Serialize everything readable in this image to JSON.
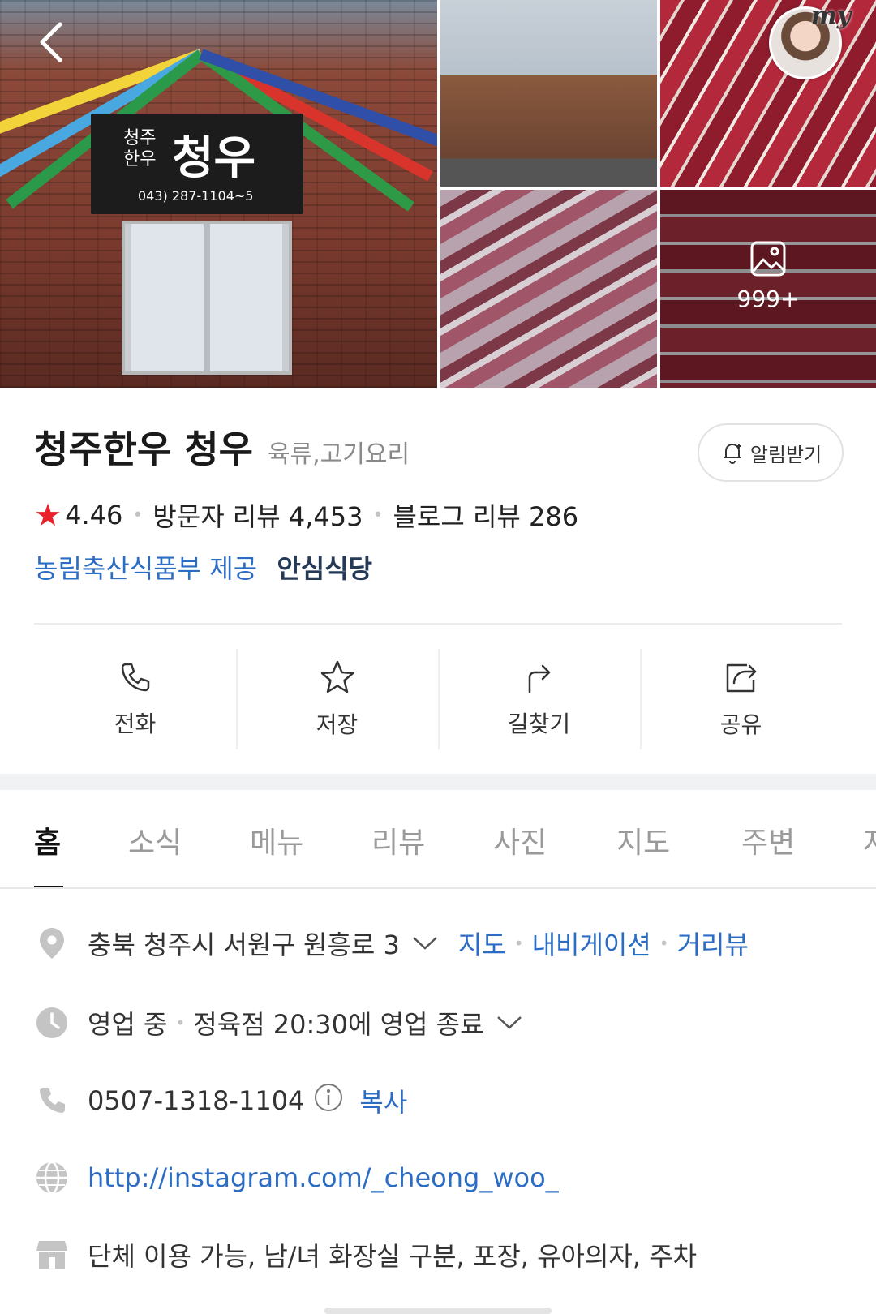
{
  "photos": {
    "sign_small": "청주\n한우",
    "sign_big": "청우",
    "sign_tel": "043) 287-1104~5",
    "more_count": "999+",
    "my_label": "my"
  },
  "header": {
    "name": "청주한우 청우",
    "category": "육류,고기요리",
    "alarm_label": "알림받기"
  },
  "stats": {
    "rating": "4.46",
    "visitor_reviews": "방문자 리뷰 4,453",
    "blog_reviews": "블로그 리뷰 286"
  },
  "cert": {
    "org": "농림축산식품부 제공",
    "name": "안심식당"
  },
  "actions": [
    {
      "label": "전화",
      "icon": "phone-icon"
    },
    {
      "label": "저장",
      "icon": "star-icon"
    },
    {
      "label": "길찾기",
      "icon": "directions-icon"
    },
    {
      "label": "공유",
      "icon": "share-icon"
    }
  ],
  "tabs": [
    "홈",
    "소식",
    "메뉴",
    "리뷰",
    "사진",
    "지도",
    "주변",
    "저"
  ],
  "details": {
    "address": "충북 청주시 서원구 원흥로 3",
    "address_links": [
      "지도",
      "내비게이션",
      "거리뷰"
    ],
    "hours_status": "영업 중",
    "hours_detail": "정육점 20:30에 영업 종료",
    "phone": "0507-1318-1104",
    "copy_label": "복사",
    "website": "http://instagram.com/_cheong_woo_",
    "amenities": "단체 이용 가능, 남/녀 화장실 구분, 포장, 유아의자, 주차"
  },
  "colors": {
    "accent_blue": "#2b6cc4",
    "star_red": "#e8222a",
    "icon_gray": "#c4c4c4"
  }
}
